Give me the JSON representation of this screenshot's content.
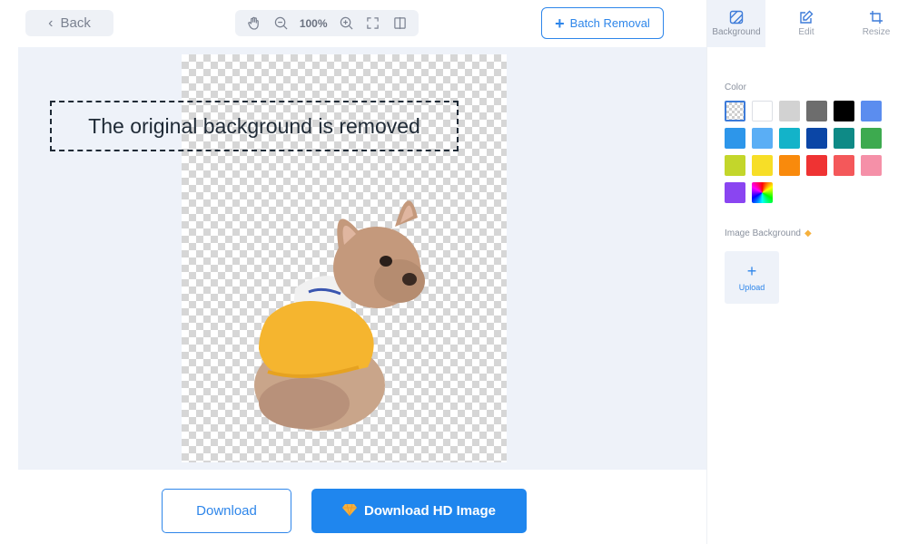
{
  "toolbar": {
    "back_label": "Back",
    "zoom_level": "100%",
    "batch_label": "Batch Removal"
  },
  "canvas": {
    "caption": "The original background is removed"
  },
  "bottom": {
    "download_label": "Download",
    "download_hd_label": "Download HD Image"
  },
  "panel": {
    "tabs": [
      {
        "label": "Background",
        "icon": "background-icon"
      },
      {
        "label": "Edit",
        "icon": "edit-icon"
      },
      {
        "label": "Resize",
        "icon": "crop-icon"
      }
    ],
    "color_title": "Color",
    "swatches": [
      "transparent",
      "#ffffff",
      "#d2d2d2",
      "#6d6d6d",
      "#000000",
      "#5b8def",
      "#2d96ea",
      "#5aaef5",
      "#13b3c9",
      "#0b46a6",
      "#0e8a86",
      "#3daa4f",
      "#c3d62b",
      "#f7de27",
      "#f98a0c",
      "#ef3333",
      "#f4585a",
      "#f590a8",
      "#8a45f1",
      "rainbow"
    ],
    "image_background_title": "Image Background",
    "upload_label": "Upload"
  },
  "colors": {
    "accent": "#2e86ea",
    "canvas_bg": "#eef2f9"
  }
}
